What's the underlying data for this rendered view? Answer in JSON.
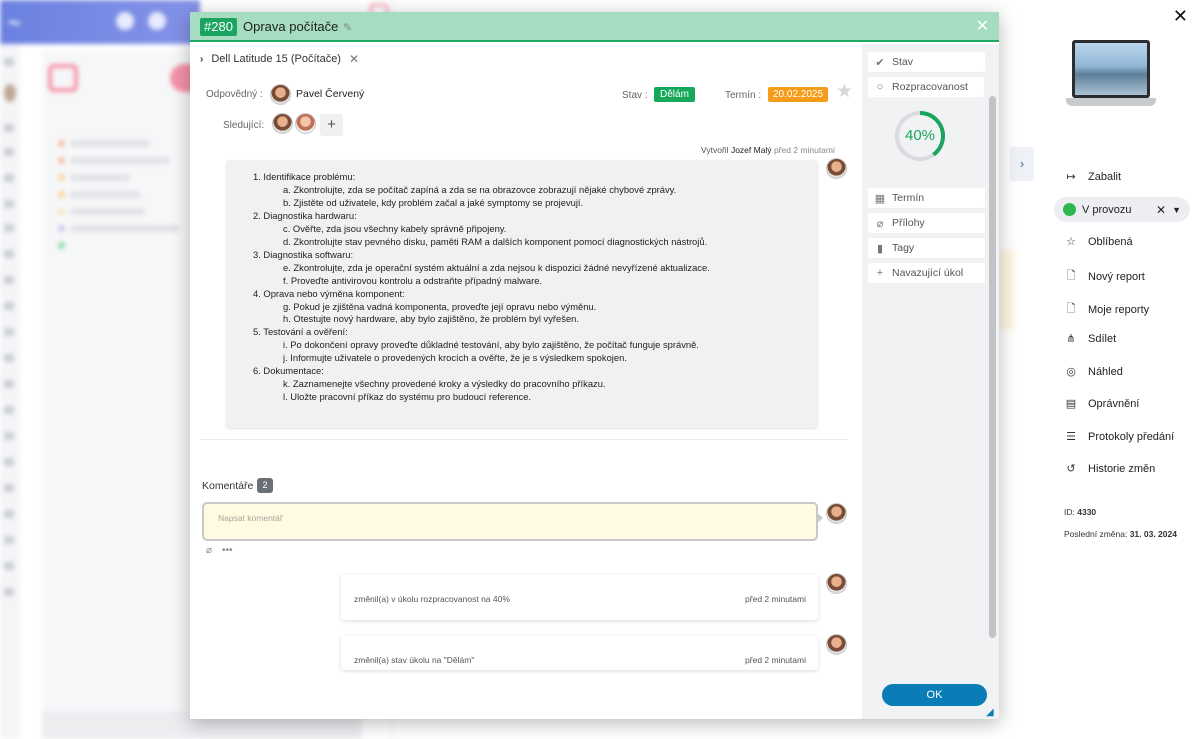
{
  "modal": {
    "task_id": "#280",
    "title": "Oprava počítače",
    "breadcrumb": "Dell Latitude 15 (Počítače)",
    "responsible_label": "Odpovědný :",
    "responsible_name": "Pavel Červený",
    "state_label": "Stav :",
    "state_value": "Dělám",
    "deadline_label": "Termín :",
    "deadline_value": "20.02.2025",
    "followers_label": "Sledující:",
    "created_prefix": "Vytvořil",
    "created_by": "Jozef Malý",
    "created_time": "před 2 minutami",
    "description": [
      {
        "text": "1. Identifikace problému:",
        "level": 0
      },
      {
        "text": "a. Zkontrolujte, zda se počítač zapíná a zda se na obrazovce zobrazují nějaké chybové zprávy.",
        "level": 1
      },
      {
        "text": "b. Zjistěte od uživatele, kdy problém začal a jaké symptomy se projevují.",
        "level": 1
      },
      {
        "text": "2. Diagnostika hardwaru:",
        "level": 0
      },
      {
        "text": "c. Ověřte, zda jsou všechny kabely správně připojeny.",
        "level": 1
      },
      {
        "text": "d. Zkontrolujte stav pevného disku, paměti RAM a dalších komponent pomocí diagnostických nástrojů.",
        "level": 1
      },
      {
        "text": "3. Diagnostika softwaru:",
        "level": 0
      },
      {
        "text": "e. Zkontrolujte, zda je operační systém aktuální a zda nejsou k dispozici žádné nevyřízené aktualizace.",
        "level": 1
      },
      {
        "text": "f. Proveďte antivirovou kontrolu a odstraňte případný malware.",
        "level": 1
      },
      {
        "text": "4. Oprava nebo výměna komponent:",
        "level": 0
      },
      {
        "text": "g. Pokud je zjištěna vadná komponenta, proveďte její opravu nebo výměnu.",
        "level": 1
      },
      {
        "text": "h. Otestujte nový hardware, aby bylo zajištěno, že problém byl vyřešen.",
        "level": 1
      },
      {
        "text": "5. Testování a ověření:",
        "level": 0
      },
      {
        "text": "i. Po dokončení opravy proveďte důkladné testování, aby bylo zajištěno, že počítač funguje správně.",
        "level": 1
      },
      {
        "text": "j. Informujte uživatele o provedených krocích a ověřte, že je s výsledkem spokojen.",
        "level": 1
      },
      {
        "text": "6. Dokumentace:",
        "level": 0
      },
      {
        "text": "k. Zaznamenejte všechny provedené kroky a výsledky do pracovního příkazu.",
        "level": 1
      },
      {
        "text": "l. Uložte pracovní příkaz do systému pro budoucí reference.",
        "level": 1
      }
    ],
    "comments_label": "Komentáře",
    "comments_count": "2",
    "comment_placeholder": "Napsat komentář",
    "activity": [
      {
        "text": "změnil(a) v úkolu rozpracovanost na 40%",
        "time": "před 2 minutami"
      },
      {
        "text": "změnil(a) stav úkolu na \"Dělám\"",
        "time": "před 2 minutami"
      }
    ],
    "side": {
      "state": "Stav",
      "progress_label": "Rozpracovanost",
      "progress_value": "40%",
      "progress_fraction": 0.4,
      "deadline": "Termín",
      "attachments": "Přílohy",
      "tags": "Tagy",
      "followup": "Navazující úkol",
      "ok": "OK"
    }
  },
  "panel": {
    "collapse": "Zabalit",
    "status": "V provozu",
    "items": [
      "Oblíbená",
      "Nový report",
      "Moje reporty",
      "Sdílet",
      "Náhled",
      "Oprávnění",
      "Protokoly předání",
      "Historie změn"
    ],
    "id_label": "ID:",
    "id_value": "4330",
    "last_change_label": "Poslední změna:",
    "last_change_value": "31. 03. 2024"
  },
  "colors": {
    "header_green": "#a6ddc0",
    "accent_green": "#19a55f",
    "orange": "#f59d1a",
    "ok_blue": "#0a7cb6"
  }
}
